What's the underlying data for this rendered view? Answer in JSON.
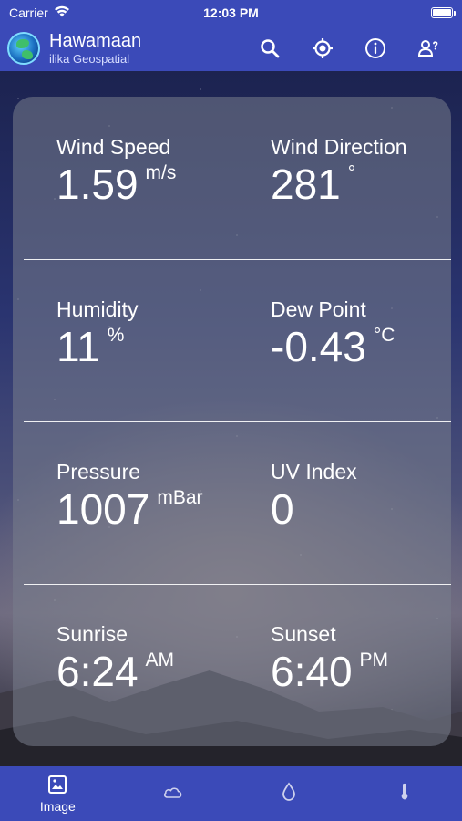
{
  "status": {
    "carrier": "Carrier",
    "time": "12:03 PM"
  },
  "header": {
    "title": "Hawamaan",
    "subtitle": "ilika Geospatial",
    "icons": [
      "search-icon",
      "crosshair-icon",
      "info-icon",
      "user-help-icon"
    ]
  },
  "metrics": [
    {
      "label": "Wind Speed",
      "value": "1.59",
      "unit": "m/s"
    },
    {
      "label": "Wind Direction",
      "value": "281",
      "unit": "°"
    },
    {
      "label": "Humidity",
      "value": "11",
      "unit": "%"
    },
    {
      "label": "Dew Point",
      "value": "-0.43",
      "unit": "°C"
    },
    {
      "label": "Pressure",
      "value": "1007",
      "unit": "mBar"
    },
    {
      "label": "UV Index",
      "value": "0",
      "unit": ""
    },
    {
      "label": "Sunrise",
      "value": "6:24",
      "unit": "AM"
    },
    {
      "label": "Sunset",
      "value": "6:40",
      "unit": "PM"
    }
  ],
  "tabs": [
    {
      "label": "Image",
      "icon": "image-icon",
      "active": true
    },
    {
      "label": "",
      "icon": "cloud-icon",
      "active": false
    },
    {
      "label": "",
      "icon": "droplet-icon",
      "active": false
    },
    {
      "label": "",
      "icon": "thermometer-icon",
      "active": false
    }
  ],
  "colors": {
    "bar": "#3b4ab8",
    "card": "#787d8c"
  }
}
